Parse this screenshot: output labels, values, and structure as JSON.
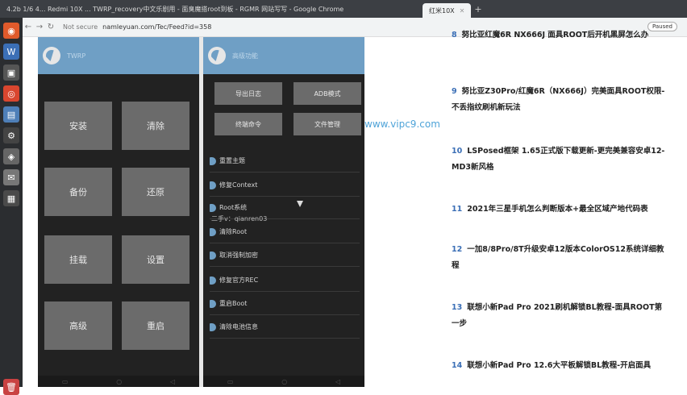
{
  "window": {
    "title": "4.2b 1/6 4... Redmi 10X ... TWRP_recovery中文乐剧用 - 面臭魔搭root到板 - RGMR 网站写写 - Google Chrome",
    "tabs": [
      {
        "label": "红米10X"
      }
    ]
  },
  "address_bar": {
    "security": "Not secure",
    "url": "namleyuan.com/Tec/Feed?id=358",
    "paused": "Paused"
  },
  "twrp_left": {
    "header": "TWRP",
    "buttons": [
      "安装",
      "清除",
      "备份",
      "还原",
      "挂载",
      "设置",
      "高级",
      "重启"
    ]
  },
  "twrp_right": {
    "header": "高级功能",
    "top_buttons": [
      "导出日志",
      "ADB模式",
      "终端命令",
      "文件管理"
    ],
    "menu": [
      "重置主题",
      "修复Context",
      "Root系统",
      "清除Root",
      "取消强制加密",
      "修复官方REC",
      "重启Boot",
      "清除电池信息"
    ],
    "watermark_sub": "二手v：qianren03"
  },
  "watermark": "www.vipc9.com",
  "articles": [
    {
      "num": "8",
      "text": "努比亚红魔6R NX666J 面具ROOT后开机黑屏怎么办"
    },
    {
      "num": "9",
      "text": "努比亚Z30Pro/红魔6R（NX666J）完美面具ROOT权限-不丢指纹刷机新玩法"
    },
    {
      "num": "10",
      "text": "LSPosed框架 1.65正式版下载更新-更完美兼容安卓12-MD3新风格"
    },
    {
      "num": "11",
      "text": "2021年三星手机怎么判断版本+最全区域产地代码表"
    },
    {
      "num": "12",
      "text": "一加8/8Pro/8T升级安卓12版本ColorOS12系统详细教程"
    },
    {
      "num": "13",
      "text": "联想小新Pad Pro 2021刷机解锁BL教程-面具ROOT第一步"
    },
    {
      "num": "14",
      "text": "联想小新Pad Pro 12.6大平板解锁BL教程-开启面具"
    }
  ],
  "colors": {
    "twrp_header": "#6f9fc5",
    "twrp_bg": "#222222",
    "button": "#6b6b6b",
    "link_num": "#3b6fb6",
    "watermark": "#4ea3d8"
  }
}
